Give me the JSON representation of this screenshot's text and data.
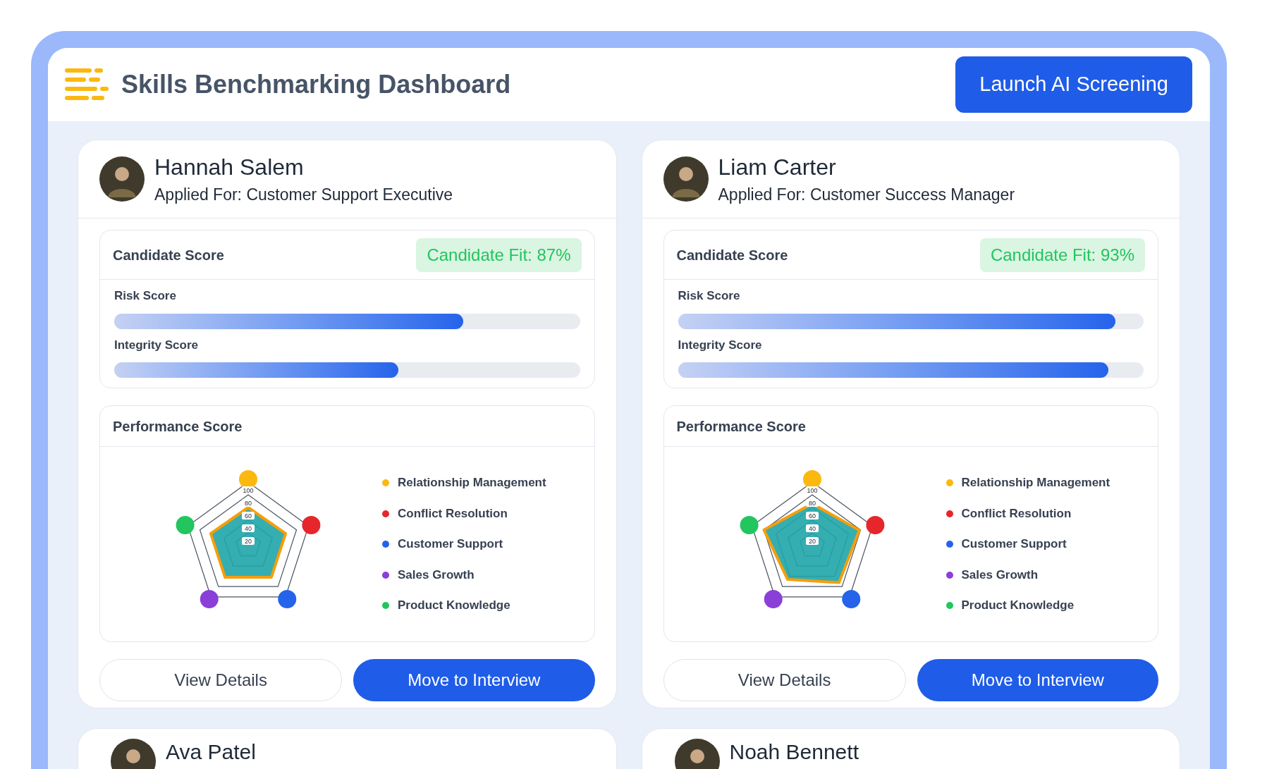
{
  "header": {
    "title": "Skills Benchmarking Dashboard",
    "action": "Launch AI Screening"
  },
  "candidates": [
    {
      "name": "Hannah Salem",
      "applied_for": "Applied For: Customer Support Executive",
      "score_title": "Candidate Score",
      "fit": "Candidate Fit: 87%",
      "bars": [
        {
          "label": "Risk Score",
          "level": 0.75
        },
        {
          "label": "Integrity Score",
          "level": 0.61
        }
      ],
      "performance_title": "Performance Score",
      "radar_ticks": [
        "100",
        "80",
        "60",
        "40",
        "20"
      ],
      "legend": [
        {
          "label": "Relationship Management",
          "color": "#fbb80f"
        },
        {
          "label": "Conflict Resolution",
          "color": "#e5262b"
        },
        {
          "label": "Customer Support",
          "color": "#2563eb"
        },
        {
          "label": "Sales Growth",
          "color": "#8b3fd9"
        },
        {
          "label": "Product Knowledge",
          "color": "#22c55e"
        }
      ],
      "buttons": [
        "View Details",
        "Move to Interview"
      ]
    },
    {
      "name": "Liam Carter",
      "applied_for": "Applied For: Customer Success Manager",
      "score_title": "Candidate Score",
      "fit": "Candidate Fit: 93%",
      "bars": [
        {
          "label": "Risk Score",
          "level": 0.94
        },
        {
          "label": "Integrity Score",
          "level": 0.925
        }
      ],
      "performance_title": "Performance Score",
      "radar_ticks": [
        "100",
        "80",
        "60",
        "40",
        "20"
      ],
      "legend": [
        {
          "label": "Relationship Management",
          "color": "#fbb80f"
        },
        {
          "label": "Conflict Resolution",
          "color": "#e5262b"
        },
        {
          "label": "Customer Support",
          "color": "#2563eb"
        },
        {
          "label": "Sales Growth",
          "color": "#8b3fd9"
        },
        {
          "label": "Product Knowledge",
          "color": "#22c55e"
        }
      ],
      "buttons": [
        "View Details",
        "Move to Interview"
      ]
    }
  ],
  "more_candidates": [
    {
      "name": "Ava Patel"
    },
    {
      "name": "Noah Bennett"
    }
  ]
}
